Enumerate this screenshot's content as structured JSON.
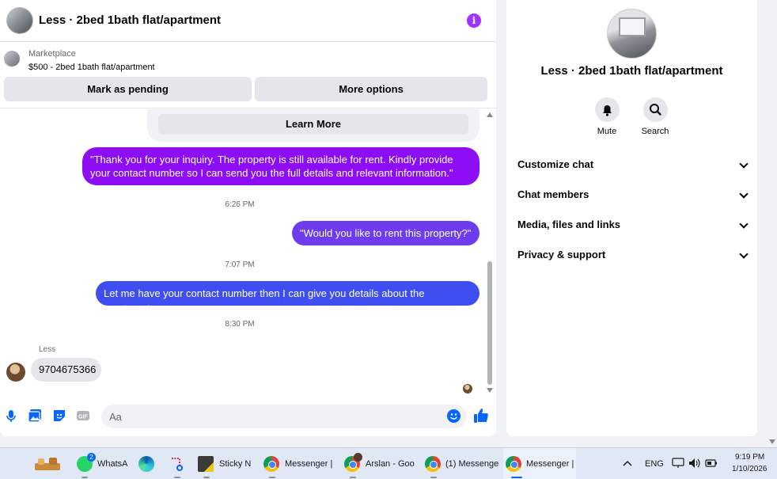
{
  "chat": {
    "title": "Less · 2bed 1bath flat/apartment",
    "marketplace": {
      "label": "Marketplace",
      "listing": "$500 - 2bed 1bath flat/apartment",
      "mark_pending": "Mark as pending",
      "more_options": "More options"
    },
    "learn_more": "Learn More",
    "messages": [
      {
        "text": "\"Thank you for your inquiry. The property is still available for rent. Kindly provide your contact number so I can send you the full details and relevant information.\"",
        "direction": "sent",
        "color": "#8d0ef4"
      },
      {
        "timestamp": "6:26 PM"
      },
      {
        "text": "\"Would you like to rent this property?\"",
        "direction": "sent",
        "color": "#6c3cee"
      },
      {
        "timestamp": "7:07 PM"
      },
      {
        "text": "Let me have your contact number then I can give you details about the apartment.",
        "direction": "sent",
        "color": "#3f4ef0"
      },
      {
        "timestamp": "8:30 PM"
      },
      {
        "sender": "Less",
        "text": "9704675366",
        "direction": "received"
      }
    ],
    "composer": {
      "placeholder": "Aa",
      "icons": [
        "microphone-icon",
        "photo-icon",
        "sticker-icon",
        "gif-icon",
        "emoji-icon",
        "like-icon"
      ]
    }
  },
  "details": {
    "title": "Less · 2bed 1bath flat/apartment",
    "actions": [
      {
        "label": "Mute",
        "icon": "bell-icon"
      },
      {
        "label": "Search",
        "icon": "search-icon"
      }
    ],
    "sections": [
      "Customize chat",
      "Chat members",
      "Media, files and links",
      "Privacy & support"
    ]
  },
  "taskbar": {
    "apps": [
      {
        "label": "",
        "icon": "widgets-icon"
      },
      {
        "label": "WhatsA",
        "icon": "whatsapp-icon",
        "badge": "2"
      },
      {
        "label": "",
        "icon": "edge-icon"
      },
      {
        "label": "",
        "icon": "snipping-tool-icon"
      },
      {
        "label": "Sticky N",
        "icon": "sticky-notes-icon"
      },
      {
        "label": "Messenger |",
        "icon": "chrome-icon"
      },
      {
        "label": "Arslan - Goo",
        "icon": "chrome-icon"
      },
      {
        "label": "(1) Messenge",
        "icon": "chrome-icon"
      },
      {
        "label": "Messenger |",
        "icon": "chrome-icon"
      }
    ],
    "language": "ENG",
    "time": "9:19 PM",
    "date": "1/10/2026"
  },
  "colors": {
    "accent": "#0866ff",
    "purple": "#a033ff"
  }
}
